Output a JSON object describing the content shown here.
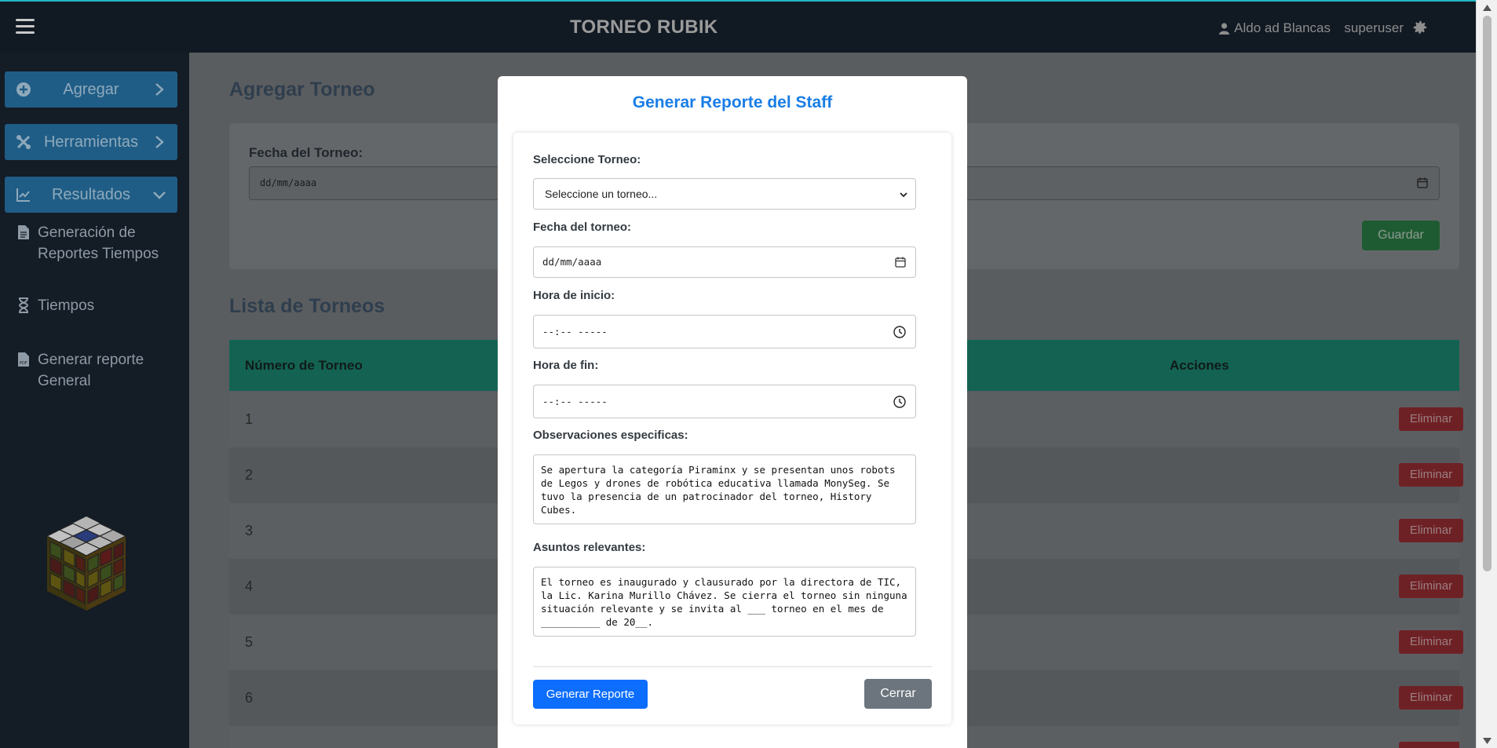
{
  "header": {
    "brand": "TORNEO RUBIK",
    "user_name": "Aldo ad Blancas",
    "role": "superuser"
  },
  "sidebar": {
    "buttons": [
      {
        "label": "Agregar"
      },
      {
        "label": "Herramientas"
      },
      {
        "label": "Resultados"
      }
    ],
    "links": [
      {
        "label": "Generación de Reportes Tiempos"
      },
      {
        "label": "Tiempos"
      },
      {
        "label": "Generar reporte General"
      }
    ]
  },
  "page": {
    "add_title": "Agregar Torneo",
    "date_label": "Fecha del Torneo:",
    "date_placeholder": "dd/mm/aaaa",
    "save_label": "Guardar",
    "list_title": "Lista de Torneos",
    "table": {
      "headers": [
        "Número de Torneo",
        "Acciones"
      ],
      "rows": [
        "1",
        "2",
        "3",
        "4",
        "5",
        "6"
      ],
      "delete_label": "Eliminar"
    }
  },
  "modal": {
    "title": "Generar Reporte del Staff",
    "tournament_label": "Seleccione Torneo:",
    "tournament_value": "Seleccione un torneo...",
    "date_label": "Fecha del torneo:",
    "date_value": "dd/mm/aaaa",
    "start_label": "Hora de inicio:",
    "start_value": "--:-- -----",
    "end_label": "Hora de fin:",
    "end_value": "--:-- -----",
    "obs_label": "Observaciones especificas:",
    "obs_value": "Se apertura la categoría Piraminx y se presentan unos robots de Legos y drones de robótica educativa llamada MonySeg. Se tuvo la presencia de un patrocinador del torneo, History Cubes.",
    "issues_label": "Asuntos relevantes:",
    "issues_value": "El torneo es inaugurado y clausurado por la directora de TIC, la Lic. Karina Murillo Chávez. Se cierra el torneo sin ninguna situación relevante y se invita al ___ torneo en el mes de __________ de 20__.",
    "generate_label": "Generar Reporte",
    "close_label": "Cerrar"
  },
  "colors": {
    "primary": "#0d6efd",
    "title_blue": "#1a7ee6",
    "secondary": "#6c757d",
    "navbar": "#111923",
    "sidebar": "#141c26"
  }
}
